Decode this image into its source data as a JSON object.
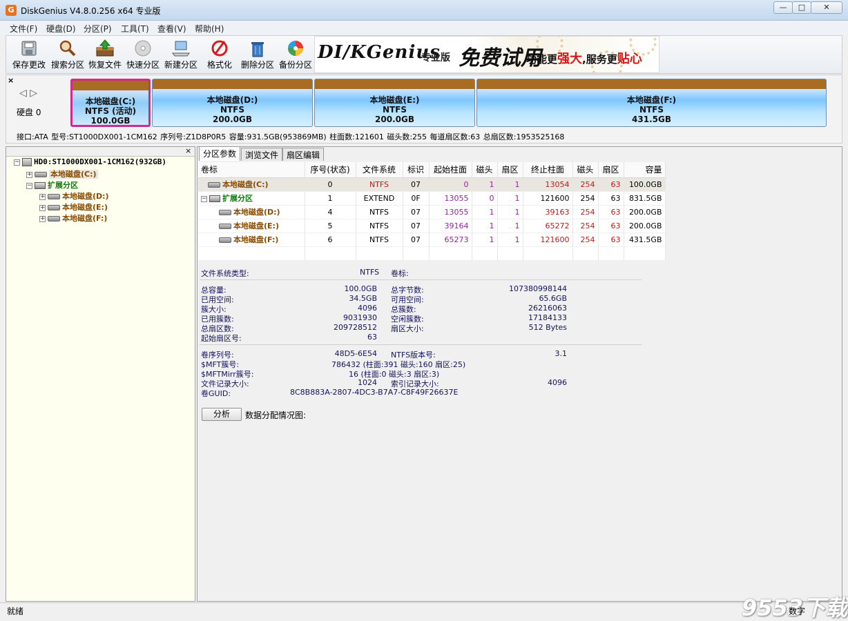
{
  "window": {
    "title": "DiskGenius V4.8.0.256 x64 专业版",
    "app_icon": "G",
    "controls": {
      "minimize": "—",
      "maximize": "□",
      "close": "✕"
    }
  },
  "menu": [
    "文件(F)",
    "硬盘(D)",
    "分区(P)",
    "工具(T)",
    "查看(V)",
    "帮助(H)"
  ],
  "toolbar": [
    {
      "label": "保存更改",
      "icon": "save-disk-icon"
    },
    {
      "label": "搜索分区",
      "icon": "magnifier-icon"
    },
    {
      "label": "恢复文件",
      "icon": "recover-file-icon"
    },
    {
      "label": "快速分区",
      "icon": "quick-partition-icon"
    },
    {
      "label": "新建分区",
      "icon": "new-partition-icon"
    },
    {
      "label": "格式化",
      "icon": "format-icon"
    },
    {
      "label": "删除分区",
      "icon": "trash-icon"
    },
    {
      "label": "备份分区",
      "icon": "backup-icon"
    }
  ],
  "banner": {
    "logo": "DI∕KGenius",
    "edition": "专业版",
    "free_trial": "免费试用",
    "slogan_a": "功能更",
    "slogan_b": "强大",
    "slogan_c": ",服务更",
    "slogan_d": "贴心"
  },
  "diskmap": {
    "close": "×",
    "nav": "◁ ▷",
    "disk_label": "硬盘 0",
    "partitions": [
      {
        "name": "本地磁盘(C:)",
        "fs": "NTFS (活动)",
        "size": "100.0GB"
      },
      {
        "name": "本地磁盘(D:)",
        "fs": "NTFS",
        "size": "200.0GB"
      },
      {
        "name": "本地磁盘(E:)",
        "fs": "NTFS",
        "size": "200.0GB"
      },
      {
        "name": "本地磁盘(F:)",
        "fs": "NTFS",
        "size": "431.5GB"
      }
    ],
    "info": "接口:ATA  型号:ST1000DX001-1CM162  序列号:Z1D8P0R5  容量:931.5GB(953869MB)  柱面数:121601  磁头数:255  每道扇区数:63  总扇区数:1953525168"
  },
  "tree": {
    "close": "×",
    "disk": "HD0:ST1000DX001-1CM162(932GB)",
    "c": "本地磁盘(C:)",
    "ext": "扩展分区",
    "d": "本地磁盘(D:)",
    "e": "本地磁盘(E:)",
    "f": "本地磁盘(F:)"
  },
  "tabs": [
    "分区参数",
    "浏览文件",
    "扇区编辑"
  ],
  "table": {
    "headers": [
      "卷标",
      "序号(状态)",
      "文件系统",
      "标识",
      "起始柱面",
      "磁头",
      "扇区",
      "终止柱面",
      "磁头",
      "扇区",
      "容量"
    ],
    "rows": [
      [
        "本地磁盘(C:)",
        "0",
        "NTFS",
        "07",
        "0",
        "1",
        "1",
        "13054",
        "254",
        "63",
        "100.0GB"
      ],
      [
        "扩展分区",
        "1",
        "EXTEND",
        "0F",
        "13055",
        "0",
        "1",
        "121600",
        "254",
        "63",
        "831.5GB"
      ],
      [
        "本地磁盘(D:)",
        "4",
        "NTFS",
        "07",
        "13055",
        "1",
        "1",
        "39163",
        "254",
        "63",
        "200.0GB"
      ],
      [
        "本地磁盘(E:)",
        "5",
        "NTFS",
        "07",
        "39164",
        "1",
        "1",
        "65272",
        "254",
        "63",
        "200.0GB"
      ],
      [
        "本地磁盘(F:)",
        "6",
        "NTFS",
        "07",
        "65273",
        "1",
        "1",
        "121600",
        "254",
        "63",
        "431.5GB"
      ]
    ]
  },
  "details": {
    "fs_type_label": "文件系统类型:",
    "fs_type": "NTFS",
    "vol_label": "卷标:",
    "total_label": "总容量:",
    "total": "100.0GB",
    "used_label": "已用空间:",
    "used": "34.5GB",
    "cluster_label": "簇大小:",
    "cluster": "4096",
    "used_clusters_label": "已用簇数:",
    "used_clusters": "9031930",
    "total_sectors_label": "总扇区数:",
    "total_sectors": "209728512",
    "start_sector_label": "起始扇区号:",
    "start_sector": "63",
    "total_bytes_label": "总字节数:",
    "total_bytes": "107380998144",
    "free_label": "可用空间:",
    "free": "65.6GB",
    "total_clusters_label": "总簇数:",
    "total_clusters": "26216063",
    "free_clusters_label": "空闲簇数:",
    "free_clusters": "17184133",
    "sector_size_label": "扇区大小:",
    "sector_size": "512 Bytes",
    "serial_label": "卷序列号:",
    "serial": "48D5-6E54",
    "mft_label": "$MFT簇号:",
    "mft": "786432 (柱面:391 磁头:160 扇区:25)",
    "mftmirr_label": "$MFTMirr簇号:",
    "mftmirr": "16 (柱面:0 磁头:3 扇区:3)",
    "frs_label": "文件记录大小:",
    "frs": "1024",
    "guid_label": "卷GUID:",
    "guid": "8C8B883A-2807-4DC3-B7A7-C8F49F26637E",
    "ntfs_ver_label": "NTFS版本号:",
    "ntfs_ver": "3.1",
    "index_size_label": "索引记录大小:",
    "index_size": "4096"
  },
  "analyze": {
    "button": "分析",
    "label": "数据分配情况图:"
  },
  "status": {
    "text": "就绪",
    "num": "数字",
    "watermark": "9553下载"
  }
}
